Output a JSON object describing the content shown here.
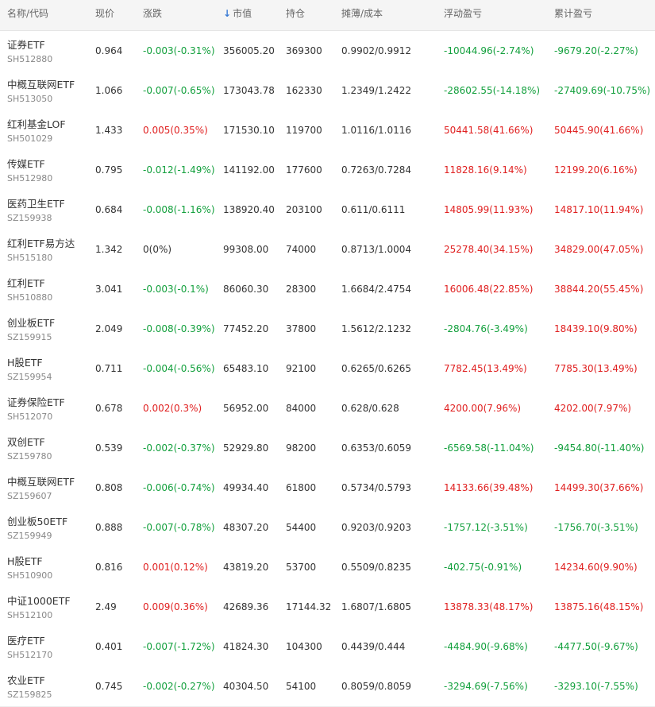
{
  "colors": {
    "up": "#e02020",
    "down": "#13a03d",
    "flat": "#333333",
    "sort_arrow": "#3a7bd5"
  },
  "header": {
    "name_code": "名称/代码",
    "price": "现价",
    "change": "涨跌",
    "market_value": "市值",
    "market_value_sort_icon": "arrow-down-icon",
    "position": "持仓",
    "cost": "摊薄/成本",
    "float_pl": "浮动盈亏",
    "total_pl": "累计盈亏"
  },
  "rows": [
    {
      "name": "证券ETF",
      "code": "SH512880",
      "price": "0.964",
      "change": "-0.003(-0.31%)",
      "change_dir": "down",
      "market_value": "356005.20",
      "position": "369300",
      "cost": "0.9902/0.9912",
      "float_pl": "-10044.96(-2.74%)",
      "float_dir": "down",
      "total_pl": "-9679.20(-2.27%)",
      "total_dir": "down"
    },
    {
      "name": "中概互联网ETF",
      "code": "SH513050",
      "price": "1.066",
      "change": "-0.007(-0.65%)",
      "change_dir": "down",
      "market_value": "173043.78",
      "position": "162330",
      "cost": "1.2349/1.2422",
      "float_pl": "-28602.55(-14.18%)",
      "float_dir": "down",
      "total_pl": "-27409.69(-10.75%)",
      "total_dir": "down"
    },
    {
      "name": "红利基金LOF",
      "code": "SH501029",
      "price": "1.433",
      "change": "0.005(0.35%)",
      "change_dir": "up",
      "market_value": "171530.10",
      "position": "119700",
      "cost": "1.0116/1.0116",
      "float_pl": "50441.58(41.66%)",
      "float_dir": "up",
      "total_pl": "50445.90(41.66%)",
      "total_dir": "up"
    },
    {
      "name": "传媒ETF",
      "code": "SH512980",
      "price": "0.795",
      "change": "-0.012(-1.49%)",
      "change_dir": "down",
      "market_value": "141192.00",
      "position": "177600",
      "cost": "0.7263/0.7284",
      "float_pl": "11828.16(9.14%)",
      "float_dir": "up",
      "total_pl": "12199.20(6.16%)",
      "total_dir": "up"
    },
    {
      "name": "医药卫生ETF",
      "code": "SZ159938",
      "price": "0.684",
      "change": "-0.008(-1.16%)",
      "change_dir": "down",
      "market_value": "138920.40",
      "position": "203100",
      "cost": "0.611/0.6111",
      "float_pl": "14805.99(11.93%)",
      "float_dir": "up",
      "total_pl": "14817.10(11.94%)",
      "total_dir": "up"
    },
    {
      "name": "红利ETF易方达",
      "code": "SH515180",
      "price": "1.342",
      "change": "0(0%)",
      "change_dir": "flat",
      "market_value": "99308.00",
      "position": "74000",
      "cost": "0.8713/1.0004",
      "float_pl": "25278.40(34.15%)",
      "float_dir": "up",
      "total_pl": "34829.00(47.05%)",
      "total_dir": "up"
    },
    {
      "name": "红利ETF",
      "code": "SH510880",
      "price": "3.041",
      "change": "-0.003(-0.1%)",
      "change_dir": "down",
      "market_value": "86060.30",
      "position": "28300",
      "cost": "1.6684/2.4754",
      "float_pl": "16006.48(22.85%)",
      "float_dir": "up",
      "total_pl": "38844.20(55.45%)",
      "total_dir": "up"
    },
    {
      "name": "创业板ETF",
      "code": "SZ159915",
      "price": "2.049",
      "change": "-0.008(-0.39%)",
      "change_dir": "down",
      "market_value": "77452.20",
      "position": "37800",
      "cost": "1.5612/2.1232",
      "float_pl": "-2804.76(-3.49%)",
      "float_dir": "down",
      "total_pl": "18439.10(9.80%)",
      "total_dir": "up"
    },
    {
      "name": "H股ETF",
      "code": "SZ159954",
      "price": "0.711",
      "change": "-0.004(-0.56%)",
      "change_dir": "down",
      "market_value": "65483.10",
      "position": "92100",
      "cost": "0.6265/0.6265",
      "float_pl": "7782.45(13.49%)",
      "float_dir": "up",
      "total_pl": "7785.30(13.49%)",
      "total_dir": "up"
    },
    {
      "name": "证券保险ETF",
      "code": "SH512070",
      "price": "0.678",
      "change": "0.002(0.3%)",
      "change_dir": "up",
      "market_value": "56952.00",
      "position": "84000",
      "cost": "0.628/0.628",
      "float_pl": "4200.00(7.96%)",
      "float_dir": "up",
      "total_pl": "4202.00(7.97%)",
      "total_dir": "up"
    },
    {
      "name": "双创ETF",
      "code": "SZ159780",
      "price": "0.539",
      "change": "-0.002(-0.37%)",
      "change_dir": "down",
      "market_value": "52929.80",
      "position": "98200",
      "cost": "0.6353/0.6059",
      "float_pl": "-6569.58(-11.04%)",
      "float_dir": "down",
      "total_pl": "-9454.80(-11.40%)",
      "total_dir": "down"
    },
    {
      "name": "中概互联网ETF",
      "code": "SZ159607",
      "price": "0.808",
      "change": "-0.006(-0.74%)",
      "change_dir": "down",
      "market_value": "49934.40",
      "position": "61800",
      "cost": "0.5734/0.5793",
      "float_pl": "14133.66(39.48%)",
      "float_dir": "up",
      "total_pl": "14499.30(37.66%)",
      "total_dir": "up"
    },
    {
      "name": "创业板50ETF",
      "code": "SZ159949",
      "price": "0.888",
      "change": "-0.007(-0.78%)",
      "change_dir": "down",
      "market_value": "48307.20",
      "position": "54400",
      "cost": "0.9203/0.9203",
      "float_pl": "-1757.12(-3.51%)",
      "float_dir": "down",
      "total_pl": "-1756.70(-3.51%)",
      "total_dir": "down"
    },
    {
      "name": "H股ETF",
      "code": "SH510900",
      "price": "0.816",
      "change": "0.001(0.12%)",
      "change_dir": "up",
      "market_value": "43819.20",
      "position": "53700",
      "cost": "0.5509/0.8235",
      "float_pl": "-402.75(-0.91%)",
      "float_dir": "down",
      "total_pl": "14234.60(9.90%)",
      "total_dir": "up"
    },
    {
      "name": "中证1000ETF",
      "code": "SH512100",
      "price": "2.49",
      "change": "0.009(0.36%)",
      "change_dir": "up",
      "market_value": "42689.36",
      "position": "17144.32",
      "cost": "1.6807/1.6805",
      "float_pl": "13878.33(48.17%)",
      "float_dir": "up",
      "total_pl": "13875.16(48.15%)",
      "total_dir": "up"
    },
    {
      "name": "医疗ETF",
      "code": "SH512170",
      "price": "0.401",
      "change": "-0.007(-1.72%)",
      "change_dir": "down",
      "market_value": "41824.30",
      "position": "104300",
      "cost": "0.4439/0.444",
      "float_pl": "-4484.90(-9.68%)",
      "float_dir": "down",
      "total_pl": "-4477.50(-9.67%)",
      "total_dir": "down"
    },
    {
      "name": "农业ETF",
      "code": "SZ159825",
      "price": "0.745",
      "change": "-0.002(-0.27%)",
      "change_dir": "down",
      "market_value": "40304.50",
      "position": "54100",
      "cost": "0.8059/0.8059",
      "float_pl": "-3294.69(-7.56%)",
      "float_dir": "down",
      "total_pl": "-3293.10(-7.55%)",
      "total_dir": "down"
    }
  ]
}
